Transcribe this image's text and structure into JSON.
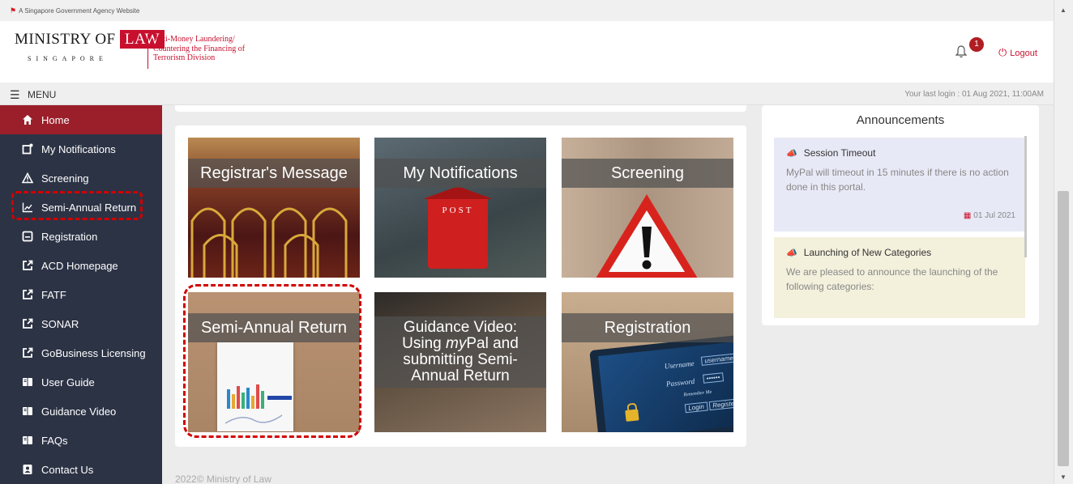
{
  "gov_banner": "A Singapore Government Agency Website",
  "logo": {
    "ministry": "MINISTRY OF",
    "law": "LAW",
    "country": "SINGAPORE"
  },
  "division": "Anti-Money Laundering/ Countering the Financing of Terrorism Division",
  "notifications": {
    "count": "1",
    "icon": "bell-icon"
  },
  "logout_label": "Logout",
  "menu_label": "MENU",
  "last_login": "Your last login : 01 Aug 2021, 11:00AM",
  "sidebar": {
    "items": [
      {
        "label": "Home",
        "icon": "home-icon"
      },
      {
        "label": "My Notifications",
        "icon": "notification-icon"
      },
      {
        "label": "Screening",
        "icon": "warning-icon"
      },
      {
        "label": "Semi-Annual Return",
        "icon": "chart-icon"
      },
      {
        "label": "Registration",
        "icon": "form-icon"
      },
      {
        "label": "ACD Homepage",
        "icon": "external-link-icon"
      },
      {
        "label": "FATF",
        "icon": "external-link-icon"
      },
      {
        "label": "SONAR",
        "icon": "external-link-icon"
      },
      {
        "label": "GoBusiness Licensing",
        "icon": "external-link-icon"
      },
      {
        "label": "User Guide",
        "icon": "book-icon"
      },
      {
        "label": "Guidance Video",
        "icon": "book-icon"
      },
      {
        "label": "FAQs",
        "icon": "book-icon"
      },
      {
        "label": "Contact Us",
        "icon": "contact-icon"
      }
    ]
  },
  "tiles": [
    {
      "label": "Registrar's Message"
    },
    {
      "label": "My Notifications",
      "image_text": "POST"
    },
    {
      "label": "Screening"
    },
    {
      "label": "Semi-Annual Return"
    },
    {
      "line1": "Guidance Video:",
      "line2_pre": "Using ",
      "line2_em": "my",
      "line2_post": "Pal and",
      "line3": "submitting Semi-",
      "line4": "Annual Return"
    },
    {
      "label": "Registration",
      "username_label": "Username",
      "username_field": "username",
      "password_label": "Password",
      "password_field": "••••••",
      "remember": "Remember Me",
      "login_btn": "Login",
      "register_btn": "Register"
    }
  ],
  "announcements": {
    "title": "Announcements",
    "items": [
      {
        "title": "Session Timeout",
        "body": "MyPal will timeout in 15 minutes if there is no action done in this portal.",
        "date": "01 Jul 2021"
      },
      {
        "title": "Launching of New Categories",
        "body": "We are pleased to announce the launching of the following categories:"
      }
    ]
  },
  "footer": "2022© Ministry of Law",
  "colors": {
    "sidebar_bg": "#2c3345",
    "active_bg": "#9b1f2a",
    "accent": "#c8102e",
    "highlight": "#d20000"
  }
}
